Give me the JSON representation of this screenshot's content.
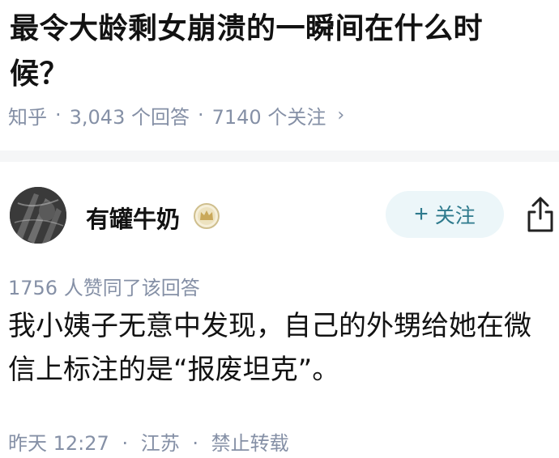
{
  "question": {
    "title": "最令大龄剩女崩溃的一瞬间在什么时候？",
    "source": "知乎",
    "answers_count": "3,043 个回答",
    "followers_count": "7140 个关注",
    "chevron": "›"
  },
  "author": {
    "name": "有罐牛奶",
    "follow_label": "关注",
    "follow_plus": "+"
  },
  "answer": {
    "votes": "1756 人赞同了该回答",
    "lines": [
      "我小姨子无意中发现，自己的外甥给她在微",
      "信上标注的是“报废坦克”。"
    ],
    "time": "昨天 12:27",
    "location": "江苏",
    "copyright": "禁止转载",
    "separator": "·"
  },
  "colors": {
    "meta_gray": "#8590a6",
    "follow_bg": "#ecf6f9",
    "follow_text": "#2e7a8d",
    "divider": "#f5f6f7"
  },
  "icons": [
    "avatar",
    "badge-icon",
    "share-icon",
    "chevron-right-icon"
  ]
}
